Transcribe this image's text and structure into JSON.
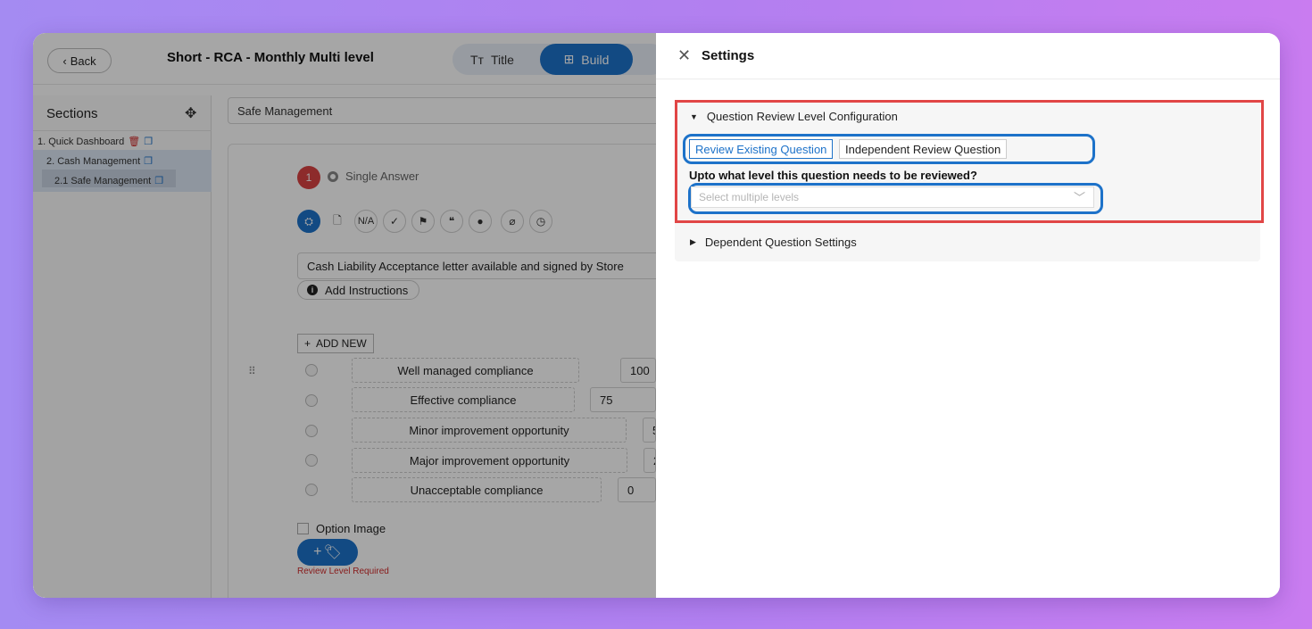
{
  "app": {
    "back_label": "Back",
    "back_chevron": "‹",
    "page_title": "Short - RCA - Monthly Multi level",
    "tabs": [
      {
        "label": "Title",
        "icon": "Tт"
      },
      {
        "label": "Build",
        "icon": "⊞"
      }
    ]
  },
  "sections": {
    "title": "Sections",
    "items": [
      {
        "label": "1. Quick Dashboard"
      },
      {
        "label": "2. Cash Management"
      },
      {
        "label": "2.1 Safe Management"
      }
    ]
  },
  "section_name": "Safe Management",
  "question": {
    "number": "1",
    "type": "Single Answer",
    "text": "Cash Liability Acceptance letter available and signed by Store",
    "na_label": "N/A",
    "add_instructions": "Add Instructions",
    "add_new": "ADD NEW",
    "options": [
      {
        "label": "Well managed compliance",
        "score": "100"
      },
      {
        "label": "Effective compliance",
        "score": "75"
      },
      {
        "label": "Minor improvement opportunity",
        "score": "5"
      },
      {
        "label": "Major improvement opportunity",
        "score": "2"
      },
      {
        "label": "Unacceptable compliance",
        "score": "0"
      }
    ],
    "option_image": "Option Image",
    "review_required": "Review Level Required"
  },
  "settings": {
    "title": "Settings",
    "review_config": {
      "header": "Question Review Level Configuration",
      "tabs": [
        "Review Existing Question",
        "Independent Review Question"
      ],
      "level_question": "Upto what level this question needs to be reviewed?",
      "select_placeholder": "Select multiple levels"
    },
    "dependent_header": "Dependent Question Settings"
  },
  "colors": {
    "accent": "#1d72c9",
    "highlight_red": "#e14646",
    "badge_red": "#d94242"
  }
}
